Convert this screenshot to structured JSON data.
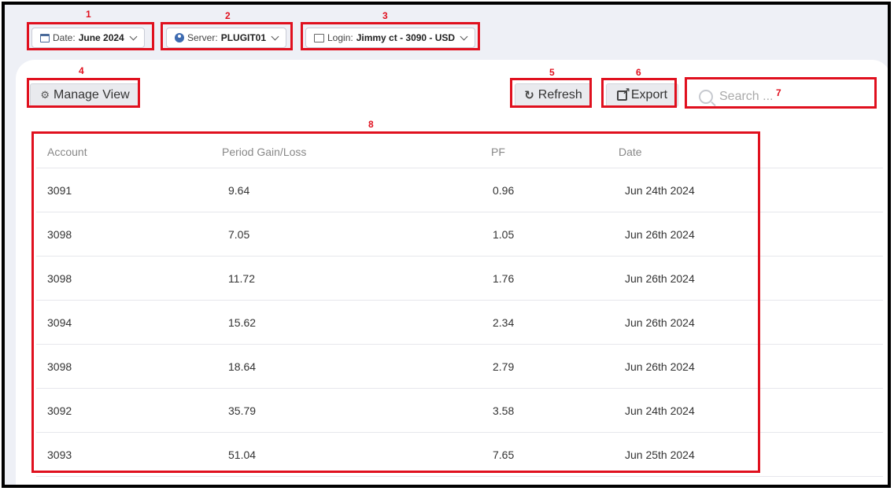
{
  "filters": {
    "date": {
      "label": "Date:",
      "value": "June 2024"
    },
    "server": {
      "label": "Server:",
      "value": "PLUGIT01"
    },
    "login": {
      "label": "Login:",
      "value": "Jimmy ct - 3090 - USD"
    }
  },
  "toolbar": {
    "manage_view_label": "Manage View",
    "refresh_label": "Refresh",
    "export_label": "Export",
    "search_placeholder": "Search ..."
  },
  "callouts": [
    "1",
    "2",
    "3",
    "4",
    "5",
    "6",
    "7",
    "8"
  ],
  "table": {
    "headers": [
      "Account",
      "Period Gain/Loss",
      "PF",
      "Date"
    ],
    "rows": [
      [
        "3091",
        "9.64",
        "0.96",
        "Jun 24th 2024"
      ],
      [
        "3098",
        "7.05",
        "1.05",
        "Jun 26th 2024"
      ],
      [
        "3098",
        "11.72",
        "1.76",
        "Jun 26th 2024"
      ],
      [
        "3094",
        "15.62",
        "2.34",
        "Jun 26th 2024"
      ],
      [
        "3098",
        "18.64",
        "2.79",
        "Jun 26th 2024"
      ],
      [
        "3092",
        "35.79",
        "3.58",
        "Jun 24th 2024"
      ],
      [
        "3093",
        "51.04",
        "7.65",
        "Jun 25th 2024"
      ]
    ]
  },
  "colors": {
    "callout": "#e0101e",
    "frame": "#000000",
    "background": "#eef0f6"
  }
}
